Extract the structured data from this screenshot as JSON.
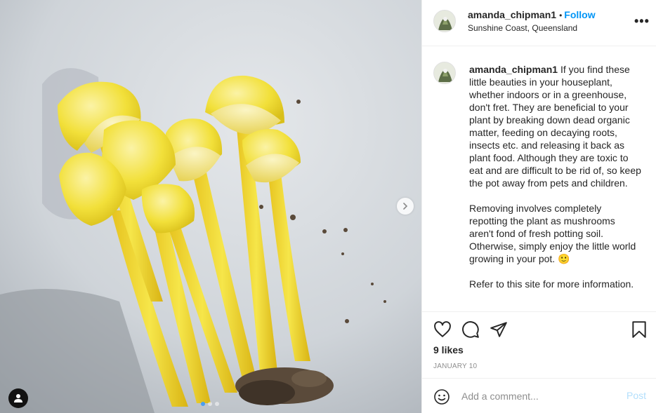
{
  "post": {
    "author": "amanda_chipman1",
    "follow_separator": "•",
    "follow_label": "Follow",
    "location": "Sunshine Coast, Queensland",
    "more_label": "•••",
    "caption_author": "amanda_chipman1",
    "caption_paragraphs": [
      "If you find these little beauties in your houseplant, whether indoors or in a greenhouse, don't fret. They are beneficial to your plant by breaking down dead organic matter, feeding on decaying roots, insects etc. and releasing it back as plant food. Although they are toxic to eat and are difficult to be rid of, so keep the pot away from pets and children.",
      "Removing involves completely repotting the plant as mushrooms aren't fond of fresh potting soil. Otherwise, simply enjoy the little world growing in your pot. 🙂",
      "Refer to this site for more information."
    ],
    "likes": "9 likes",
    "date": "JANUARY 10"
  },
  "comment": {
    "placeholder": "Add a comment...",
    "post_label": "Post"
  },
  "carousel": {
    "total": 3,
    "active_index": 0
  },
  "icons": {
    "like": "heart-icon",
    "comment": "comment-icon",
    "share": "share-icon",
    "save": "bookmark-icon",
    "emoji": "emoji-icon",
    "tag": "user-tag-icon",
    "next": "chevron-right-icon"
  },
  "colors": {
    "follow_blue": "#0095f6",
    "post_disabled": "#b2dffc",
    "mushroom_yellow": "#f2e03a",
    "background_cloth": "#cdd2d7"
  }
}
